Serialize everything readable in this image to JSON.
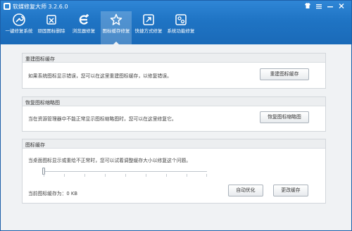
{
  "app": {
    "title": "软媒修复大师 3.2.6.0"
  },
  "toolbar": {
    "items": [
      {
        "label": "一键修复系统",
        "icon": "wrench-icon"
      },
      {
        "label": "顽固图标删除",
        "icon": "trash-icon"
      },
      {
        "label": "浏览器修复",
        "icon": "browser-e-icon"
      },
      {
        "label": "图标缓存修复",
        "icon": "star-icon",
        "active": true
      },
      {
        "label": "快捷方式修复",
        "icon": "shortcut-icon"
      },
      {
        "label": "系统功能修复",
        "icon": "gears-icon"
      }
    ]
  },
  "panels": {
    "rebuild": {
      "title": "重建图标缓存",
      "desc": "如果系统图标显示错误，您可以在这里重建图标缓存，以修复错误。",
      "button": "重建图标缓存"
    },
    "restore": {
      "title": "恢复图标缩略图",
      "desc": "当在资源管理器中不能正常显示图标缩略图时，您可以在这里修复它。",
      "button": "恢复图标缩略图"
    },
    "cache": {
      "title": "图标缓存",
      "desc": "当桌面图标显示或重绘不正常时，您可以试着调整缓存大小以修复这个问题。",
      "size_label": "当前图标缓存为：0 KB",
      "slider_value": 0,
      "auto_button": "自动优化",
      "change_button": "更改缓存"
    }
  },
  "colors": {
    "accent": "#1f74c4",
    "panel_bg": "#ffffff",
    "window_bg": "#f0f2f4"
  }
}
